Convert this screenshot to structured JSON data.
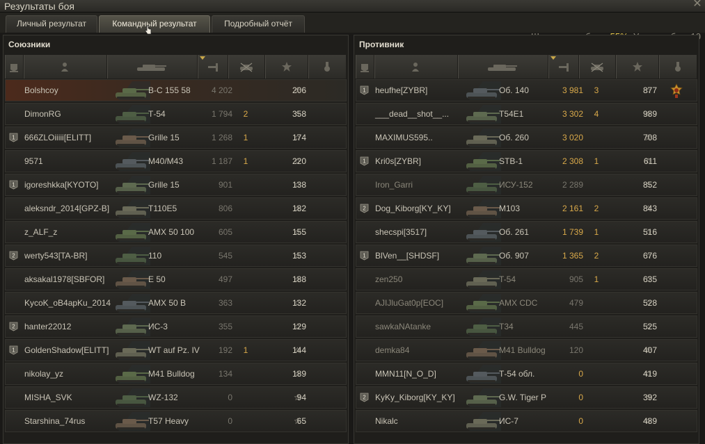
{
  "window": {
    "title": "Результаты боя"
  },
  "tabs": [
    {
      "label": "Личный результат"
    },
    {
      "label": "Командный результат"
    },
    {
      "label": "Подробный отчёт"
    }
  ],
  "battle_info": {
    "chance_label": "Шансы на победу:",
    "chance_value": "55%",
    "level_label": ". Уровень боя: 10"
  },
  "allies": {
    "title": "Союзники",
    "rows": [
      {
        "name": "Bolshcoy",
        "vehicle": "В-С 155 58",
        "damage": "4 202",
        "kills": "",
        "xp": "206",
        "platoon": "",
        "own": true,
        "dead": false,
        "hi": false
      },
      {
        "name": "DimonRG",
        "vehicle": "Т-54",
        "damage": "1 794",
        "kills": "2",
        "xp": "358",
        "platoon": "",
        "own": false,
        "dead": false,
        "hi": false
      },
      {
        "name": "666ZLOiiiii[ELITT]",
        "vehicle": "Grille 15",
        "damage": "1 268",
        "kills": "1",
        "xp": "174",
        "platoon": "1",
        "own": false,
        "dead": false,
        "hi": false
      },
      {
        "name": "9571",
        "vehicle": "M40/M43",
        "damage": "1 187",
        "kills": "1",
        "xp": "220",
        "platoon": "",
        "own": false,
        "dead": false,
        "hi": false
      },
      {
        "name": "igoreshkka[KYOTO]",
        "vehicle": "Grille 15",
        "damage": "901",
        "kills": "",
        "xp": "138",
        "platoon": "1",
        "own": false,
        "dead": false,
        "hi": false
      },
      {
        "name": "aleksndr_2014[GPZ-B]",
        "vehicle": "T110E5",
        "damage": "806",
        "kills": "",
        "xp": "182",
        "platoon": "",
        "own": false,
        "dead": false,
        "hi": false
      },
      {
        "name": "z_ALF_z",
        "vehicle": "AMX 50 100",
        "damage": "605",
        "kills": "",
        "xp": "155",
        "platoon": "",
        "own": false,
        "dead": false,
        "hi": false
      },
      {
        "name": "werty543[TA-BR]",
        "vehicle": "110",
        "damage": "545",
        "kills": "",
        "xp": "153",
        "platoon": "2",
        "own": false,
        "dead": false,
        "hi": false
      },
      {
        "name": "aksakal1978[SBFOR]",
        "vehicle": "E 50",
        "damage": "497",
        "kills": "",
        "xp": "188",
        "platoon": "",
        "own": false,
        "dead": false,
        "hi": false
      },
      {
        "name": "KycoK_oB4apKu_2014",
        "vehicle": "AMX 50 B",
        "damage": "363",
        "kills": "",
        "xp": "132",
        "platoon": "",
        "own": false,
        "dead": false,
        "hi": false
      },
      {
        "name": "hanter22012",
        "vehicle": "ИС-3",
        "damage": "355",
        "kills": "",
        "xp": "129",
        "platoon": "2",
        "own": false,
        "dead": false,
        "hi": false
      },
      {
        "name": "GoldenShadow[ELITT]",
        "vehicle": "WT auf Pz. IV",
        "damage": "192",
        "kills": "1",
        "xp": "144",
        "platoon": "1",
        "own": false,
        "dead": false,
        "hi": false
      },
      {
        "name": "nikolay_yz",
        "vehicle": "M41 Bulldog",
        "damage": "134",
        "kills": "",
        "xp": "189",
        "platoon": "",
        "own": false,
        "dead": false,
        "hi": false
      },
      {
        "name": "MISHA_SVK",
        "vehicle": "WZ-132",
        "damage": "0",
        "kills": "",
        "xp": "94",
        "platoon": "",
        "own": false,
        "dead": false,
        "hi": false
      },
      {
        "name": "Starshina_74rus",
        "vehicle": "T57 Heavy",
        "damage": "0",
        "kills": "",
        "xp": "65",
        "platoon": "",
        "own": false,
        "dead": false,
        "hi": false
      }
    ]
  },
  "enemies": {
    "title": "Противник",
    "rows": [
      {
        "name": "heufhe[ZYBR]",
        "vehicle": "Об. 140",
        "damage": "3 981",
        "kills": "3",
        "xp": "877",
        "platoon": "1",
        "own": false,
        "dead": false,
        "hi": true,
        "medal": true
      },
      {
        "name": "___dead__shot__...",
        "vehicle": "T54E1",
        "damage": "3 302",
        "kills": "4",
        "xp": "989",
        "platoon": "",
        "own": false,
        "dead": false,
        "hi": true
      },
      {
        "name": "MAXIMUS595..",
        "vehicle": "Об. 260",
        "damage": "3 020",
        "kills": "",
        "xp": "708",
        "platoon": "",
        "own": false,
        "dead": false,
        "hi": true
      },
      {
        "name": "Kri0s[ZYBR]",
        "vehicle": "STB-1",
        "damage": "2 308",
        "kills": "1",
        "xp": "611",
        "platoon": "1",
        "own": false,
        "dead": false,
        "hi": true
      },
      {
        "name": "Iron_Garri",
        "vehicle": "ИСУ-152",
        "damage": "2 289",
        "kills": "",
        "xp": "852",
        "platoon": "",
        "own": false,
        "dead": true,
        "hi": false
      },
      {
        "name": "Dog_Kiborg[KY_KY]",
        "vehicle": "M103",
        "damage": "2 161",
        "kills": "2",
        "xp": "843",
        "platoon": "2",
        "own": false,
        "dead": false,
        "hi": true
      },
      {
        "name": "shecspi[3517]",
        "vehicle": "Об. 261",
        "damage": "1 739",
        "kills": "1",
        "xp": "516",
        "platoon": "",
        "own": false,
        "dead": false,
        "hi": true
      },
      {
        "name": "BlVen__[SHDSF]",
        "vehicle": "Об. 907",
        "damage": "1 365",
        "kills": "2",
        "xp": "676",
        "platoon": "1",
        "own": false,
        "dead": false,
        "hi": true
      },
      {
        "name": "zen250",
        "vehicle": "T-54",
        "damage": "905",
        "kills": "1",
        "xp": "635",
        "platoon": "",
        "own": false,
        "dead": true,
        "hi": false
      },
      {
        "name": "AJIJluGat0p[EOC]",
        "vehicle": "AMX CDC",
        "damage": "479",
        "kills": "",
        "xp": "528",
        "platoon": "",
        "own": false,
        "dead": true,
        "hi": false
      },
      {
        "name": "sawkaNAtanke",
        "vehicle": "T34",
        "damage": "445",
        "kills": "",
        "xp": "525",
        "platoon": "",
        "own": false,
        "dead": true,
        "hi": false
      },
      {
        "name": "demka84",
        "vehicle": "M41 Bulldog",
        "damage": "120",
        "kills": "",
        "xp": "407",
        "platoon": "",
        "own": false,
        "dead": true,
        "hi": false
      },
      {
        "name": "MMN11[N_O_D]",
        "vehicle": "Т-54 обл.",
        "damage": "0",
        "kills": "",
        "xp": "419",
        "platoon": "",
        "own": false,
        "dead": false,
        "hi": true
      },
      {
        "name": "KyKy_Kiborg[KY_KY]",
        "vehicle": "G.W. Tiger P",
        "damage": "0",
        "kills": "",
        "xp": "392",
        "platoon": "2",
        "own": false,
        "dead": false,
        "hi": true
      },
      {
        "name": "Nikalc",
        "vehicle": "ИС-7",
        "damage": "0",
        "kills": "",
        "xp": "489",
        "platoon": "",
        "own": false,
        "dead": false,
        "hi": true
      }
    ]
  },
  "columns": [
    {
      "icon": "platoon-icon"
    },
    {
      "icon": "player-icon"
    },
    {
      "icon": "tank-icon"
    },
    {
      "icon": "damage-icon"
    },
    {
      "icon": "kills-icon"
    },
    {
      "icon": "xp-star-icon"
    },
    {
      "icon": "medal-icon"
    }
  ],
  "colors": {
    "accent": "#e8c84a",
    "damage_high": "#d9a94a",
    "own_row": "#4c2a1c"
  }
}
